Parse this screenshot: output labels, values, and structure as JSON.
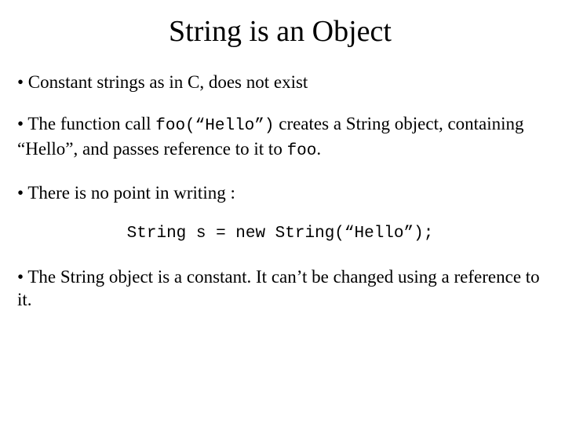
{
  "title": "String is an Object",
  "b1": "•  Constant strings as in C, does not exist",
  "b2a": "•  The function call ",
  "b2code": "foo(“Hello”)",
  "b2b": " creates a String object, containing “Hello”, and passes reference to it to ",
  "b2code2": "foo",
  "b2c": ".",
  "b3": "• There is no point in writing :",
  "codeLine": "String s = new String(“Hello”);",
  "b4": "• The String object is a constant. It can’t be changed using a reference to it."
}
